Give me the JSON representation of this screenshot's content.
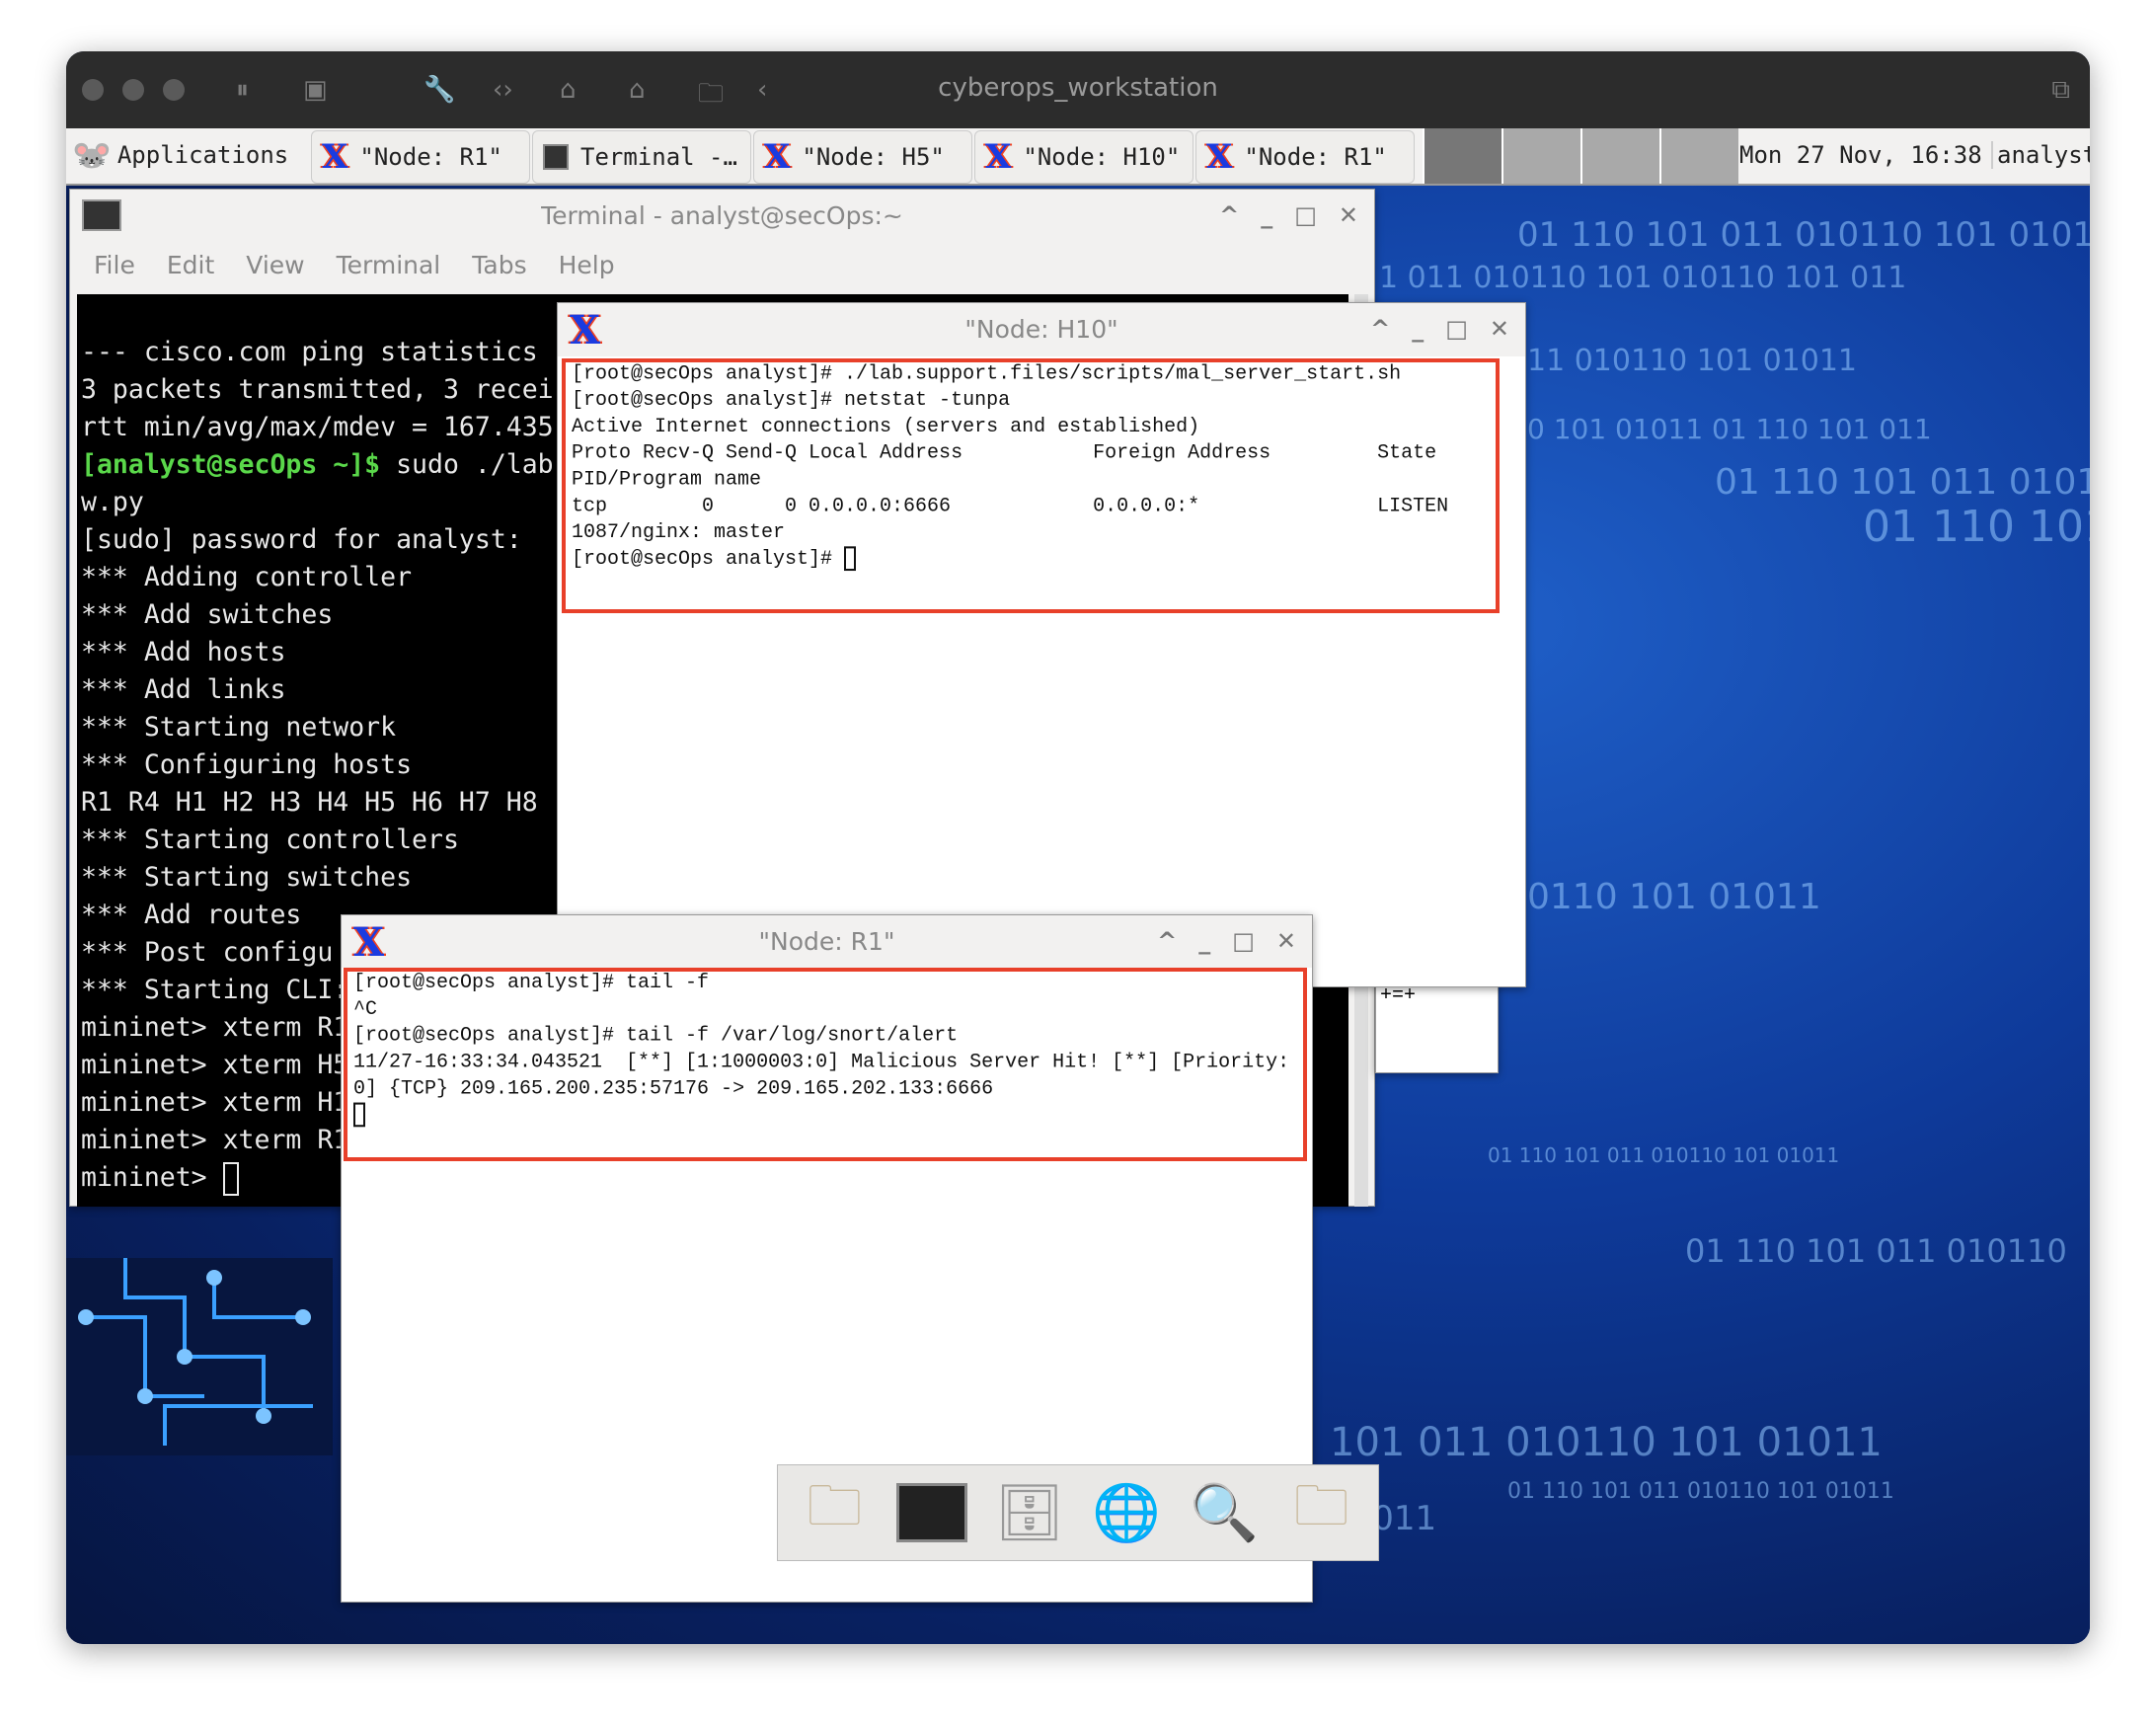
{
  "host": {
    "title": "cyberops_workstation"
  },
  "taskbar": {
    "applications_label": "Applications",
    "tasks": [
      {
        "label": "\"Node: R1\"",
        "icon": "xterm-icon"
      },
      {
        "label": "Terminal -…",
        "icon": "terminal-icon"
      },
      {
        "label": "\"Node: H5\"",
        "icon": "xterm-icon"
      },
      {
        "label": "\"Node: H10\"",
        "icon": "xterm-icon"
      },
      {
        "label": "\"Node: R1\"",
        "icon": "xterm-icon"
      }
    ],
    "clock": "Mon 27 Nov, 16:38",
    "user": "analyst"
  },
  "wallpaper": {
    "binary": [
      "01 110 101 011 010110 101 0101",
      "1 011 010110 101 010110 101 011",
      "11 010110 101 01011",
      "0 101 01011   01 110 101 011",
      "01 110 101 011 0101",
      "01 110 101",
      "0110 101 01011",
      "01 110 101 011 010110 101 01011",
      "01 110 101 011 010110",
      "101 011 010110 101 01011",
      "01 110 101 011 010110 101 01011",
      "01011"
    ]
  },
  "terminal": {
    "title": "Terminal - analyst@secOps:~",
    "menu": [
      "File",
      "Edit",
      "View",
      "Terminal",
      "Tabs",
      "Help"
    ],
    "lines": [
      "--- cisco.com ping statistics",
      "3 packets transmitted, 3 recei",
      "rtt min/avg/max/mdev = 167.435"
    ],
    "prompt": "[analyst@secOps ~]$",
    "command": " sudo ./lab",
    "lines2": [
      "w.py",
      "[sudo] password for analyst:",
      "*** Adding controller",
      "*** Add switches",
      "*** Add hosts",
      "*** Add links",
      "*** Starting network",
      "*** Configuring hosts",
      "R1 R4 H1 H2 H3 H4 H5 H6 H7 H8",
      "*** Starting controllers",
      "*** Starting switches",
      "*** Add routes",
      "*** Post configu",
      "*** Starting CLI:",
      "mininet> xterm R1",
      "mininet> xterm H5",
      "mininet> xterm H1",
      "mininet> xterm R1"
    ],
    "last_prompt": "mininet> "
  },
  "node_h10": {
    "title": "\"Node: H10\"",
    "lines": [
      "[root@secOps analyst]# ./lab.support.files/scripts/mal_server_start.sh",
      "[root@secOps analyst]# netstat -tunpa",
      "Active Internet connections (servers and established)",
      "Proto Recv-Q Send-Q Local Address           Foreign Address         State",
      "PID/Program name",
      "tcp        0      0 0.0.0.0:6666            0.0.0.0:*               LISTEN",
      "1087/nginx: master"
    ],
    "prompt": "[root@secOps analyst]# "
  },
  "hidden_window": {
    "text": "+=+"
  },
  "node_r1": {
    "title": "\"Node: R1\"",
    "lines": [
      "[root@secOps analyst]# tail -f",
      "^C",
      "[root@secOps analyst]# tail -f /var/log/snort/alert",
      "11/27-16:33:34.043521  [**] [1:1000003:0] Malicious Server Hit! [**] [Priority:",
      "0] {TCP} 209.165.200.235:57176 -> 209.165.202.133:6666"
    ]
  },
  "dock": [
    "folder-home-icon",
    "terminal-icon",
    "file-cabinet-icon",
    "web-browser-icon",
    "search-icon",
    "folder-icon"
  ],
  "colors": {
    "highlight": "#e8402a",
    "prompt": "#5ad84a"
  }
}
